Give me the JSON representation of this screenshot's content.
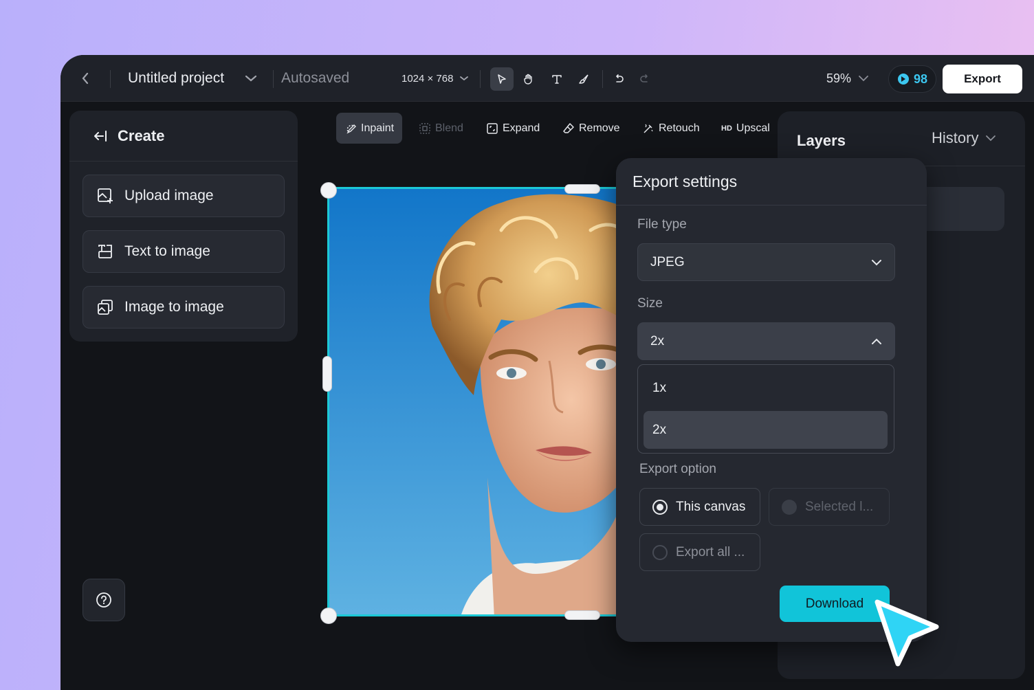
{
  "topbar": {
    "project_title": "Untitled project",
    "autosave_status": "Autosaved",
    "canvas_size": "1024 × 768",
    "zoom": "59%",
    "credits": "98",
    "export_label": "Export"
  },
  "left_panel": {
    "header": "Create",
    "items": [
      {
        "label": "Upload image",
        "icon": "upload-image-icon"
      },
      {
        "label": "Text to image",
        "icon": "text-to-image-icon"
      },
      {
        "label": "Image to image",
        "icon": "image-to-image-icon"
      }
    ]
  },
  "toolstrip": {
    "inpaint": "Inpaint",
    "blend": "Blend",
    "expand": "Expand",
    "remove": "Remove",
    "retouch": "Retouch",
    "upscale_badge": "HD",
    "upscale": "Upscal"
  },
  "right_panel": {
    "tab_layers": "Layers",
    "tab_history": "History"
  },
  "export_settings": {
    "title": "Export settings",
    "file_type_label": "File type",
    "file_type_value": "JPEG",
    "size_label": "Size",
    "size_value": "2x",
    "size_options": [
      "1x",
      "2x"
    ],
    "selected_size": "2x",
    "export_option_label": "Export option",
    "options": {
      "this_canvas": "This canvas",
      "selected": "Selected l...",
      "export_all": "Export all ..."
    },
    "selected_option": "This canvas",
    "download_label": "Download"
  },
  "colors": {
    "accent": "#11c4d9",
    "credits": "#3cc7f0",
    "selection_border": "#1cc9d6",
    "panel_bg": "#1f2229",
    "app_bg": "#121418"
  }
}
